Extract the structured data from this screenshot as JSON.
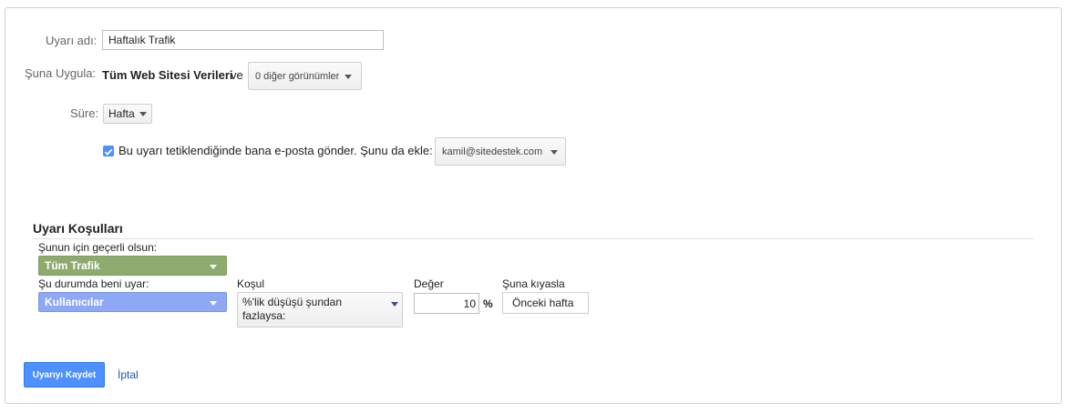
{
  "form": {
    "name_label": "Uyarı adı:",
    "name_value": "Haftalık Trafik",
    "apply_label": "Şuna Uygula:",
    "apply_view": "Tüm Web Sitesi Verileri",
    "apply_and": "ve",
    "other_views": "0 diğer görünümler",
    "period_label": "Süre:",
    "period_value": "Hafta",
    "email_checked": true,
    "email_text": "Bu uyarı tetiklendiğinde bana e-posta gönder. Şunu da ekle:",
    "email_value": "kamil@sitedestek.com"
  },
  "conditions": {
    "title": "Uyarı Koşulları",
    "applies_to_label": "Şunun için geçerli olsun:",
    "applies_to_value": "Tüm Trafik",
    "alert_me_label": "Şu durumda beni uyar:",
    "alert_me_value": "Kullanıcılar",
    "condition_label": "Koşul",
    "condition_value": "%'lik düşüşü şundan fazlaysa:",
    "value_label": "Değer",
    "value_value": "10",
    "percent_sign": "%",
    "compare_label": "Şuna kıyasla",
    "compare_value": "Önceki hafta"
  },
  "actions": {
    "save_label": "Uyarıyı Kaydet",
    "cancel_label": "İptal"
  },
  "colors": {
    "green": "#8eab6d",
    "blue": "#8ea8f6",
    "primary": "#4d90fe",
    "link": "#1a5aa6"
  }
}
